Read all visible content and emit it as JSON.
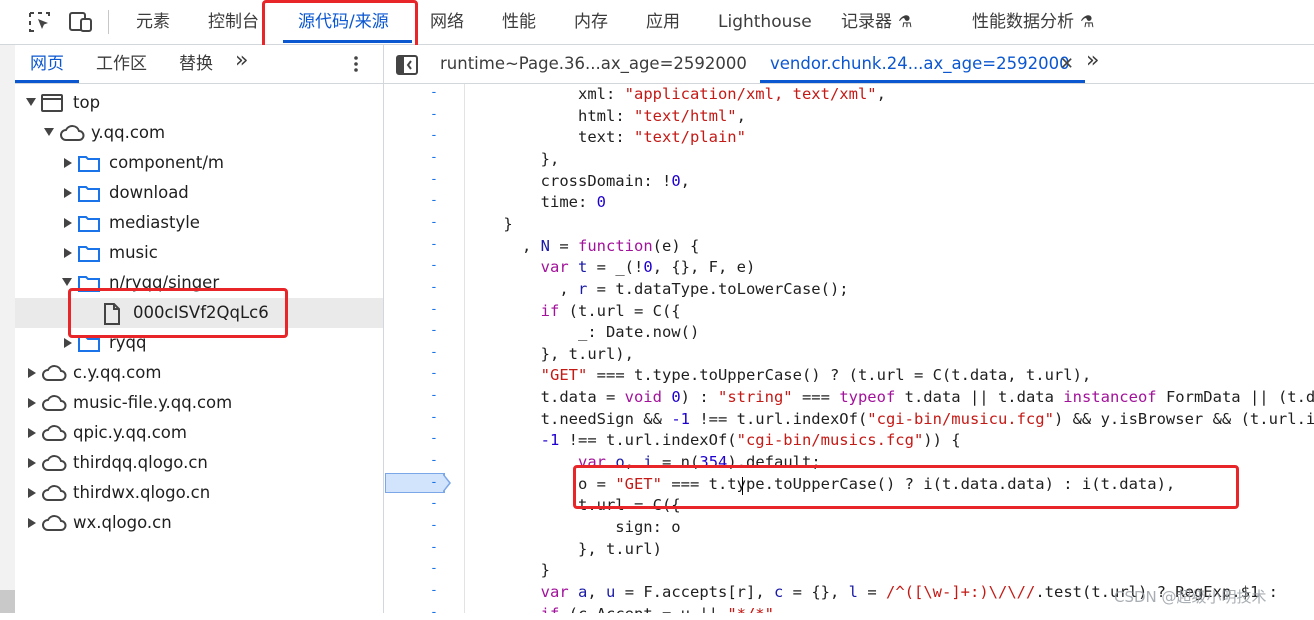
{
  "toolbar": {
    "icons": [
      "inspect-element-icon",
      "device-toolbar-icon"
    ],
    "tabs": [
      {
        "label": "元素"
      },
      {
        "label": "控制台"
      },
      {
        "label": "源代码/来源"
      },
      {
        "label": "网络"
      },
      {
        "label": "性能"
      },
      {
        "label": "内存"
      },
      {
        "label": "应用"
      },
      {
        "label": "Lighthouse"
      },
      {
        "label": "记录器",
        "flask": "⚗"
      },
      {
        "label": "性能数据分析",
        "flask": "⚗"
      }
    ],
    "active_tab": "源代码/来源"
  },
  "navigator": {
    "tabs": [
      {
        "label": "网页"
      },
      {
        "label": "工作区"
      },
      {
        "label": "替换"
      }
    ],
    "more_label": "»",
    "tree": [
      {
        "label": "top",
        "icon": "frame-icon",
        "expanded": true
      },
      {
        "label": "y.qq.com",
        "icon": "cloud-icon",
        "expanded": true
      },
      {
        "label": "component/m",
        "icon": "folder-icon",
        "expanded": false
      },
      {
        "label": "download",
        "icon": "folder-icon",
        "expanded": false
      },
      {
        "label": "mediastyle",
        "icon": "folder-icon",
        "expanded": false
      },
      {
        "label": "music",
        "icon": "folder-icon",
        "expanded": false
      },
      {
        "label": "n/ryqq/singer",
        "icon": "folder-icon",
        "expanded": true
      },
      {
        "label": "000cISVf2QqLc6",
        "icon": "file-icon",
        "selected": true
      },
      {
        "label": "ryqq",
        "icon": "folder-icon",
        "expanded": false
      },
      {
        "label": "c.y.qq.com",
        "icon": "cloud-icon",
        "expanded": false
      },
      {
        "label": "music-file.y.qq.com",
        "icon": "cloud-icon",
        "expanded": false
      },
      {
        "label": "qpic.y.qq.com",
        "icon": "cloud-icon",
        "expanded": false
      },
      {
        "label": "thirdqq.qlogo.cn",
        "icon": "cloud-icon",
        "expanded": false
      },
      {
        "label": "thirdwx.qlogo.cn",
        "icon": "cloud-icon",
        "expanded": false
      },
      {
        "label": "wx.qlogo.cn",
        "icon": "cloud-icon",
        "expanded": false
      }
    ]
  },
  "editor": {
    "tabs": [
      {
        "label": "runtime~Page.36...ax_age=2592000"
      },
      {
        "label": "vendor.chunk.24...ax_age=2592000",
        "close": "✕"
      }
    ],
    "more_label": "»",
    "gutter_mark": "-",
    "code_lines": [
      [
        [
          "            ",
          "p"
        ],
        [
          "xml",
          "p"
        ],
        [
          ": ",
          "p"
        ],
        [
          "\"application/xml, text/xml\"",
          "s"
        ],
        [
          ",",
          "p"
        ]
      ],
      [
        [
          "            ",
          "p"
        ],
        [
          "html",
          "p"
        ],
        [
          ": ",
          "p"
        ],
        [
          "\"text/html\"",
          "s"
        ],
        [
          ",",
          "p"
        ]
      ],
      [
        [
          "            ",
          "p"
        ],
        [
          "text",
          "p"
        ],
        [
          ": ",
          "p"
        ],
        [
          "\"text/plain\"",
          "s"
        ]
      ],
      [
        [
          "        ",
          "p"
        ],
        [
          "},",
          "p"
        ]
      ],
      [
        [
          "        ",
          "p"
        ],
        [
          "crossDomain",
          "p"
        ],
        [
          ": !",
          "p"
        ],
        [
          "0",
          "n"
        ],
        [
          ",",
          "p"
        ]
      ],
      [
        [
          "        ",
          "p"
        ],
        [
          "time",
          "p"
        ],
        [
          ": ",
          "p"
        ],
        [
          "0",
          "n"
        ]
      ],
      [
        [
          "    ",
          "p"
        ],
        [
          "}",
          "p"
        ]
      ],
      [
        [
          "      , ",
          "p"
        ],
        [
          "N",
          "v"
        ],
        [
          " = ",
          "p"
        ],
        [
          "function",
          "k"
        ],
        [
          "(",
          "p"
        ],
        [
          "e",
          "p"
        ],
        [
          ") {",
          "p"
        ]
      ],
      [
        [
          "        ",
          "p"
        ],
        [
          "var",
          "k"
        ],
        [
          " ",
          "p"
        ],
        [
          "t",
          "v"
        ],
        [
          " = _(!",
          "p"
        ],
        [
          "0",
          "n"
        ],
        [
          ", {}, F, e)",
          "p"
        ]
      ],
      [
        [
          "          , ",
          "p"
        ],
        [
          "r",
          "v"
        ],
        [
          " = t.dataType.toLowerCase();",
          "p"
        ]
      ],
      [
        [
          "        ",
          "p"
        ],
        [
          "if",
          "k"
        ],
        [
          " (t.url = C({",
          "p"
        ]
      ],
      [
        [
          "            _: Date.now()",
          "p"
        ]
      ],
      [
        [
          "        }, t.url),",
          "p"
        ]
      ],
      [
        [
          "        ",
          "p"
        ],
        [
          "\"GET\"",
          "s"
        ],
        [
          " === t.type.toUpperCase() ? (t.url = C(t.data, t.url),",
          "p"
        ]
      ],
      [
        [
          "        t.data = ",
          "p"
        ],
        [
          "void",
          "k"
        ],
        [
          " ",
          "p"
        ],
        [
          "0",
          "n"
        ],
        [
          ") : ",
          "p"
        ],
        [
          "\"string\"",
          "s"
        ],
        [
          " === ",
          "p"
        ],
        [
          "typeof",
          "k"
        ],
        [
          " t.data || t.data ",
          "p"
        ],
        [
          "instanceof",
          "k"
        ],
        [
          " FormData || (t.data =",
          "p"
        ]
      ],
      [
        [
          "        t.needSign && ",
          "p"
        ],
        [
          "-1",
          "n"
        ],
        [
          " !== t.url.indexOf(",
          "p"
        ],
        [
          "\"cgi-bin/musicu.fcg\"",
          "s"
        ],
        [
          ") && y.isBrowser && (t.url.indexOf(",
          "p"
        ]
      ],
      [
        [
          "        ",
          "p"
        ],
        [
          "-1",
          "n"
        ],
        [
          " !== t.url.indexOf(",
          "p"
        ],
        [
          "\"cgi-bin/musics.fcg\"",
          "s"
        ],
        [
          ")) {",
          "p"
        ]
      ],
      [
        [
          "            ",
          "p"
        ],
        [
          "var",
          "k"
        ],
        [
          " ",
          "p"
        ],
        [
          "o",
          "v"
        ],
        [
          ", ",
          "p"
        ],
        [
          "i",
          "v"
        ],
        [
          " = n(",
          "p"
        ],
        [
          "354",
          "n"
        ],
        [
          ").default;",
          "p"
        ]
      ],
      [
        [
          "            o = ",
          "p"
        ],
        [
          "\"GET\"",
          "s"
        ],
        [
          " === t.type.toUpperCase() ? i(t.data.data) : i(t.data),",
          "p"
        ]
      ],
      [
        [
          "            t.url = C({",
          "p"
        ]
      ],
      [
        [
          "                sign: o",
          "p"
        ]
      ],
      [
        [
          "            }, t.url)",
          "p"
        ]
      ],
      [
        [
          "        }",
          "p"
        ]
      ],
      [
        [
          "        ",
          "p"
        ],
        [
          "var",
          "k"
        ],
        [
          " ",
          "p"
        ],
        [
          "a",
          "v"
        ],
        [
          ", ",
          "p"
        ],
        [
          "u",
          "v"
        ],
        [
          " = F.accepts[r], ",
          "p"
        ],
        [
          "c",
          "v"
        ],
        [
          " = {}, ",
          "p"
        ],
        [
          "l",
          "v"
        ],
        [
          " = ",
          "p"
        ],
        [
          "/^([\\w-]+:)\\/\\//",
          "s"
        ],
        [
          ".test(t.url) ? RegExp.$1 : ",
          "p"
        ]
      ],
      [
        [
          "        ",
          "p"
        ],
        [
          "if",
          "k"
        ],
        [
          " (c.Accept = u || ",
          "p"
        ],
        [
          "\"*/*\"",
          "s"
        ]
      ]
    ]
  },
  "watermark": "CSDN @超级小明技术",
  "colors": {
    "accent": "#0b57d0",
    "highlight_box": "#e8262a",
    "code_string": "#c41a16",
    "code_keyword": "#a2129a",
    "code_number": "#1c00cf",
    "code_variable": "#1a1aa6"
  }
}
